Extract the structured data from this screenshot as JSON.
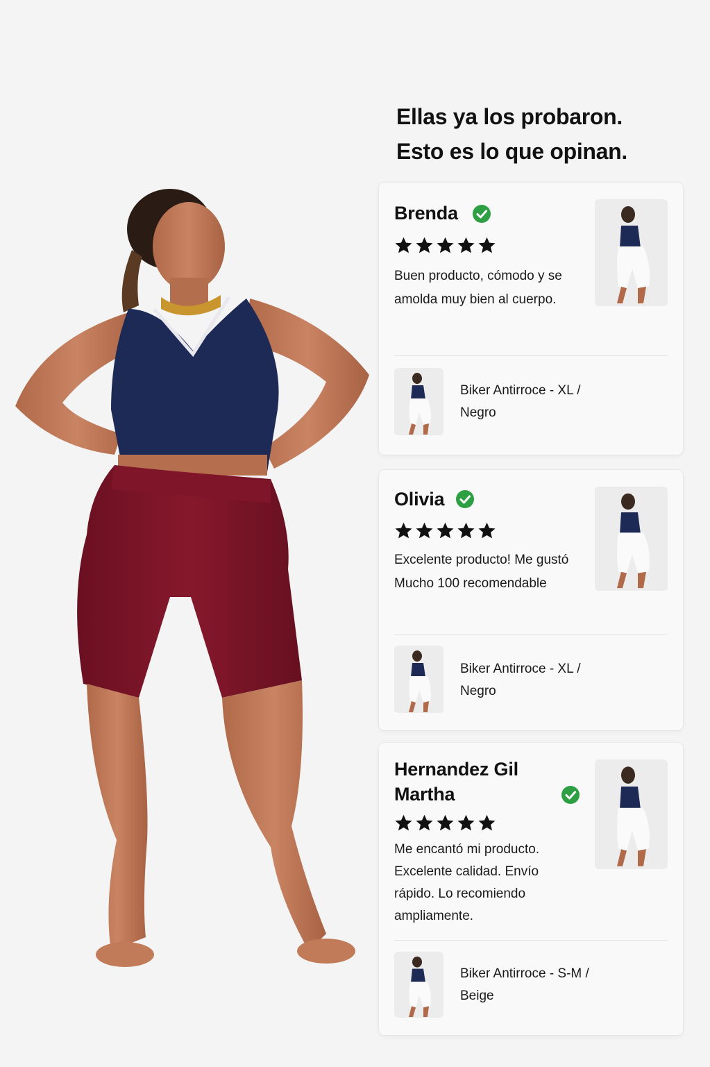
{
  "heading": {
    "line1": "Ellas ya los probaron.",
    "line2": "Esto es lo que opinan."
  },
  "colors": {
    "background": "#f4f4f5",
    "card": "#f9f9f9",
    "verified": "#2ea043",
    "star": "#111111",
    "top": "#1c2a55",
    "shorts": "#7a1426"
  },
  "reviews": [
    {
      "name": "Brenda",
      "verified": true,
      "rating": 5,
      "text": "Buen producto, cómodo y se amolda muy bien al cuerpo.",
      "product": "Biker Antirroce - XL / Negro"
    },
    {
      "name": "Olivia",
      "verified": true,
      "rating": 5,
      "text": "Excelente producto! Me gustó Mucho 100 recomendable",
      "product": "Biker Antirroce - XL / Negro"
    },
    {
      "name": "Hernandez Gil Martha",
      "verified": true,
      "rating": 5,
      "text": "Me encantó mi producto. Excelente calidad. Envío rápido. Lo recomiendo ampliamente.",
      "product": "Biker Antirroce - S-M / Beige"
    }
  ]
}
